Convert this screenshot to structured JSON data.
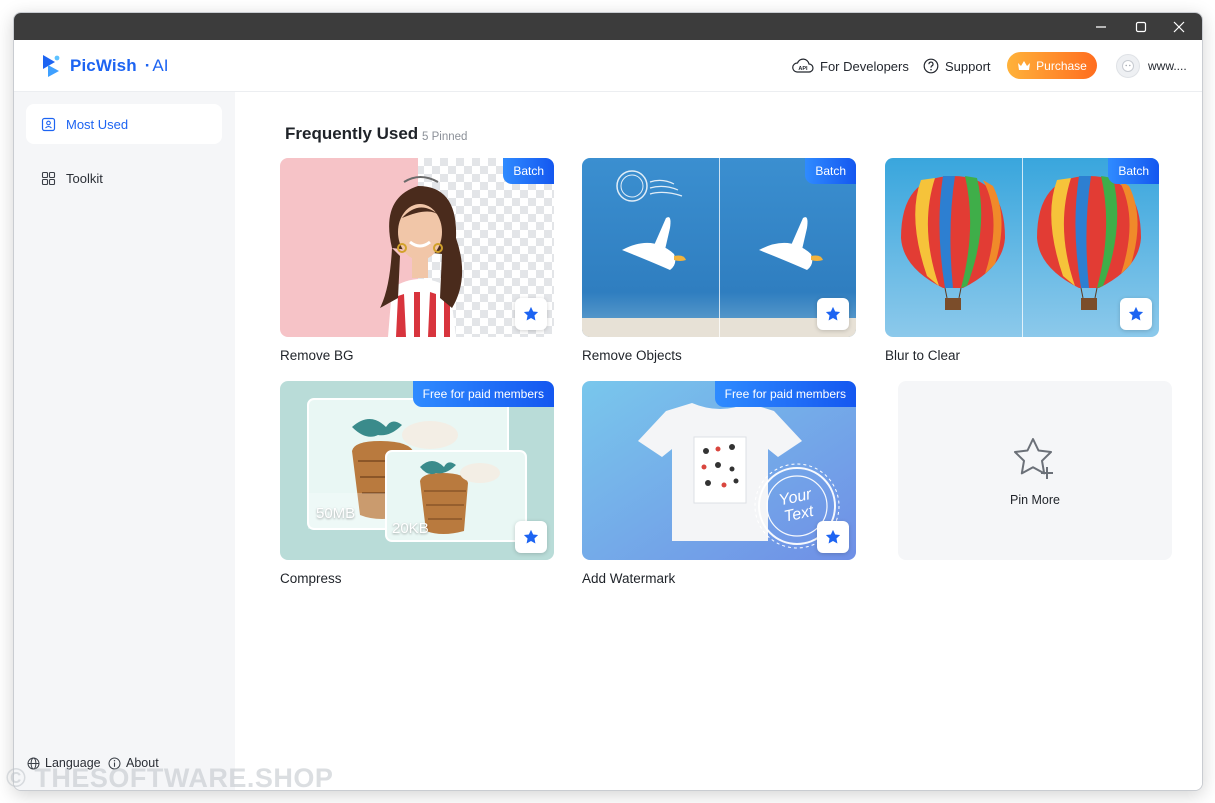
{
  "app": {
    "name": "PicWish",
    "suffix": "AI"
  },
  "header": {
    "developers_label": "For Developers",
    "support_label": "Support",
    "purchase_label": "Purchase",
    "user_name": "www...."
  },
  "sidebar": {
    "items": [
      {
        "label": "Most Used",
        "active": true
      },
      {
        "label": "Toolkit",
        "active": false
      }
    ],
    "footer": {
      "language_label": "Language",
      "about_label": "About"
    }
  },
  "main": {
    "section_title": "Frequently Used",
    "pinned_count": "5 Pinned",
    "cards": [
      {
        "label": "Remove BG",
        "badge": "Batch"
      },
      {
        "label": "Remove Objects",
        "badge": "Batch"
      },
      {
        "label": "Blur to Clear",
        "badge": "Batch"
      },
      {
        "label": "Compress",
        "badge": "Free for paid members",
        "big_size": "50MB",
        "small_size": "20KB"
      },
      {
        "label": "Add Watermark",
        "badge": "Free for paid members",
        "stamp_line1": "Your",
        "stamp_line2": "Text"
      }
    ],
    "pin_more_label": "Pin More"
  },
  "watermark_text": "© THESOFTWARE.SHOP",
  "colors": {
    "accent": "#1d64f2",
    "purchase_start": "#ffb23a",
    "purchase_end": "#ff6d1f",
    "sidebar_bg": "#f5f6f8"
  }
}
